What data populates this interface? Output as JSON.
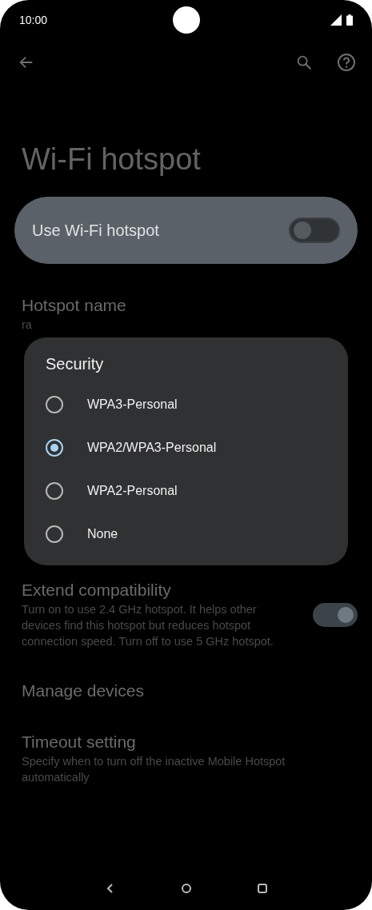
{
  "status_bar": {
    "time": "10:00"
  },
  "title": "Wi-Fi hotspot",
  "main_switch": {
    "label": "Use Wi-Fi hotspot",
    "on": false
  },
  "hotspot_name": {
    "label": "Hotspot name",
    "value": "ra"
  },
  "dialog": {
    "title": "Security",
    "options": [
      {
        "label": "WPA3-Personal",
        "selected": false
      },
      {
        "label": "WPA2/WPA3-Personal",
        "selected": true
      },
      {
        "label": "WPA2-Personal",
        "selected": false
      },
      {
        "label": "None",
        "selected": false
      }
    ]
  },
  "settings": [
    {
      "kind": "switch",
      "title": "Extend compatibility",
      "description": "Turn on to use 2.4 GHz hotspot. It helps other devices find this hotspot but reduces hotspot connection speed. Turn off to use 5 GHz hotspot.",
      "on": true
    },
    {
      "kind": "link",
      "title": "Manage devices"
    },
    {
      "kind": "link",
      "title": "Timeout setting",
      "description": "Specify when to turn off the inactive Mobile Hotspot automatically"
    }
  ]
}
